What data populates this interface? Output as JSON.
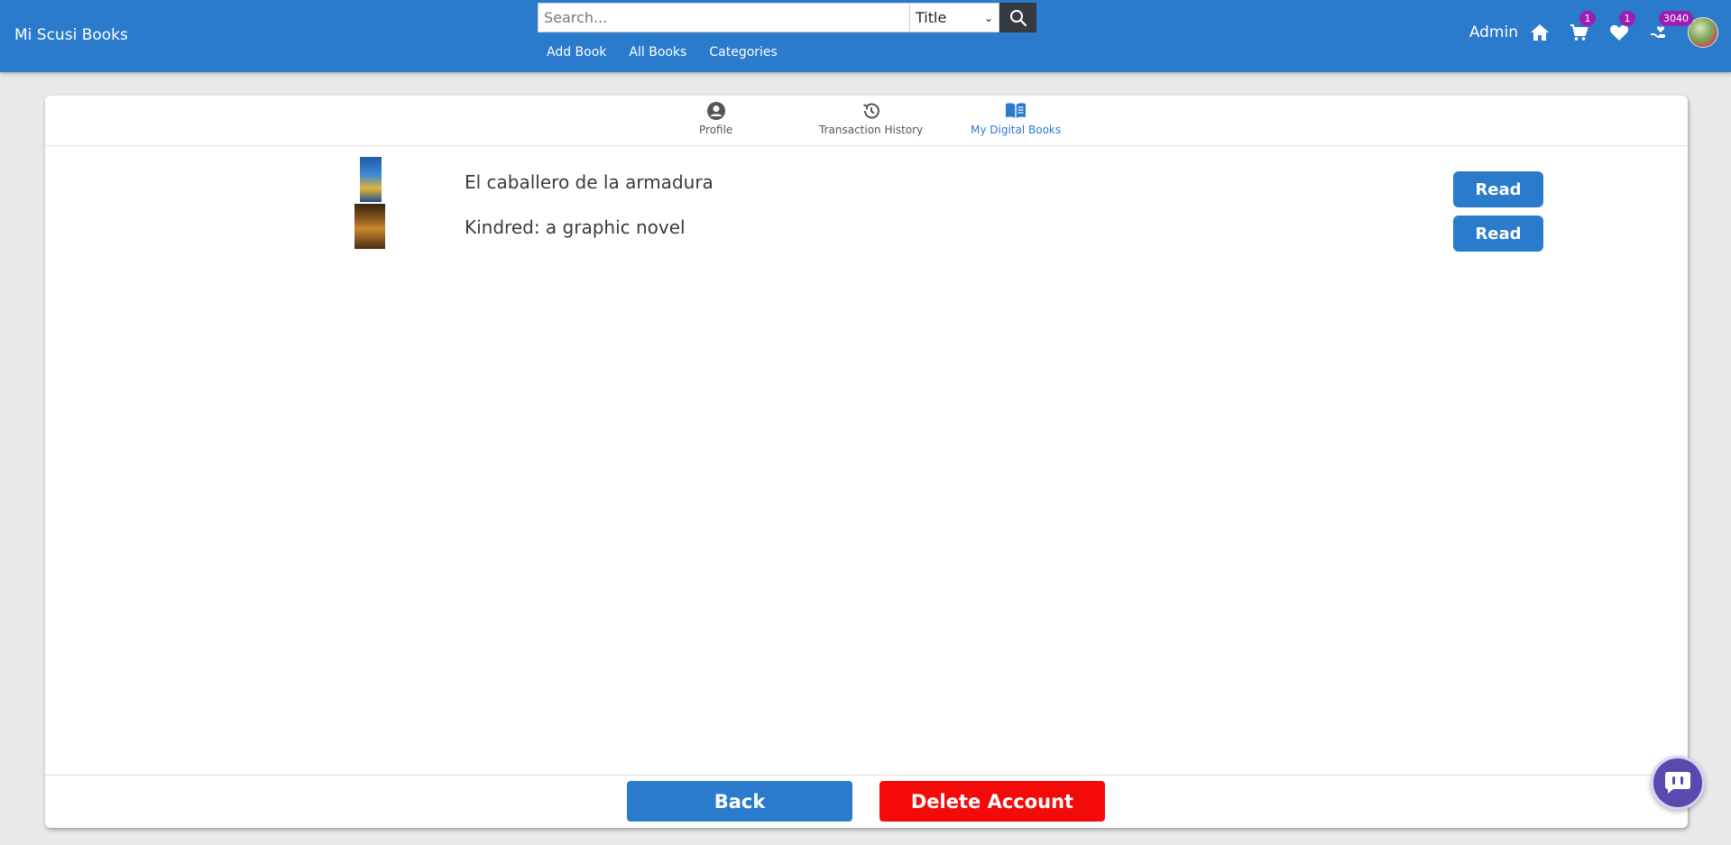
{
  "brand": "Mi Scusi Books",
  "search": {
    "placeholder": "Search...",
    "value": "",
    "filter_selected": "Title"
  },
  "nav": {
    "links": [
      "Add Book",
      "All Books",
      "Categories"
    ]
  },
  "user": {
    "name": "Admin",
    "cart_count": "1",
    "wishlist_count": "1",
    "points_count": "3040"
  },
  "tabs": [
    {
      "label": "Profile",
      "icon": "user-circle-icon",
      "active": false
    },
    {
      "label": "Transaction History",
      "icon": "history-icon",
      "active": false
    },
    {
      "label": "My Digital Books",
      "icon": "open-book-icon",
      "active": true
    }
  ],
  "books": [
    {
      "title": "El caballero de la armadura",
      "action": "Read"
    },
    {
      "title": "Kindred: a graphic novel",
      "action": "Read"
    }
  ],
  "footer": {
    "back_label": "Back",
    "delete_label": "Delete Account"
  },
  "colors": {
    "primary": "#2b7bcc",
    "danger": "#f50a0a",
    "badge": "#9b1fb5",
    "dark_button": "#343a40"
  }
}
